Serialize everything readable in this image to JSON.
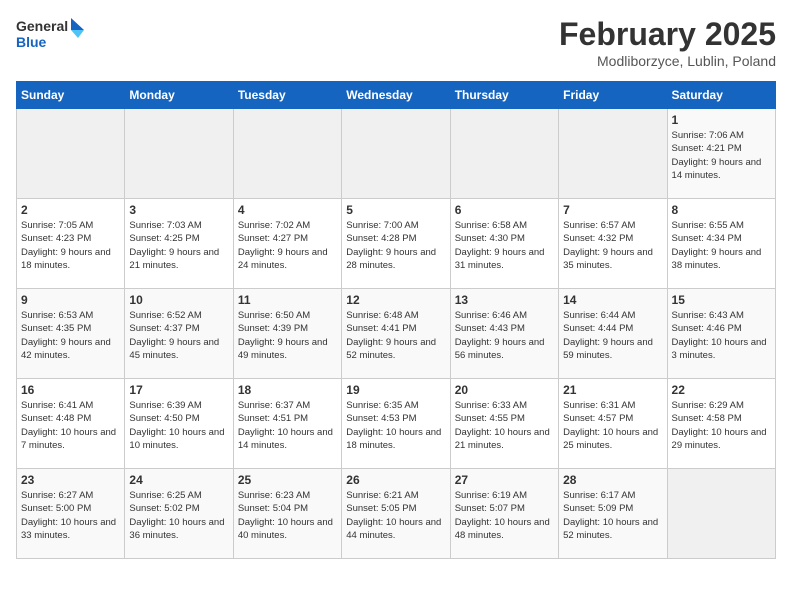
{
  "header": {
    "logo_general": "General",
    "logo_blue": "Blue",
    "title": "February 2025",
    "subtitle": "Modliborzyce, Lublin, Poland"
  },
  "days_of_week": [
    "Sunday",
    "Monday",
    "Tuesday",
    "Wednesday",
    "Thursday",
    "Friday",
    "Saturday"
  ],
  "weeks": [
    [
      {
        "day": "",
        "info": ""
      },
      {
        "day": "",
        "info": ""
      },
      {
        "day": "",
        "info": ""
      },
      {
        "day": "",
        "info": ""
      },
      {
        "day": "",
        "info": ""
      },
      {
        "day": "",
        "info": ""
      },
      {
        "day": "1",
        "info": "Sunrise: 7:06 AM\nSunset: 4:21 PM\nDaylight: 9 hours and 14 minutes."
      }
    ],
    [
      {
        "day": "2",
        "info": "Sunrise: 7:05 AM\nSunset: 4:23 PM\nDaylight: 9 hours and 18 minutes."
      },
      {
        "day": "3",
        "info": "Sunrise: 7:03 AM\nSunset: 4:25 PM\nDaylight: 9 hours and 21 minutes."
      },
      {
        "day": "4",
        "info": "Sunrise: 7:02 AM\nSunset: 4:27 PM\nDaylight: 9 hours and 24 minutes."
      },
      {
        "day": "5",
        "info": "Sunrise: 7:00 AM\nSunset: 4:28 PM\nDaylight: 9 hours and 28 minutes."
      },
      {
        "day": "6",
        "info": "Sunrise: 6:58 AM\nSunset: 4:30 PM\nDaylight: 9 hours and 31 minutes."
      },
      {
        "day": "7",
        "info": "Sunrise: 6:57 AM\nSunset: 4:32 PM\nDaylight: 9 hours and 35 minutes."
      },
      {
        "day": "8",
        "info": "Sunrise: 6:55 AM\nSunset: 4:34 PM\nDaylight: 9 hours and 38 minutes."
      }
    ],
    [
      {
        "day": "9",
        "info": "Sunrise: 6:53 AM\nSunset: 4:35 PM\nDaylight: 9 hours and 42 minutes."
      },
      {
        "day": "10",
        "info": "Sunrise: 6:52 AM\nSunset: 4:37 PM\nDaylight: 9 hours and 45 minutes."
      },
      {
        "day": "11",
        "info": "Sunrise: 6:50 AM\nSunset: 4:39 PM\nDaylight: 9 hours and 49 minutes."
      },
      {
        "day": "12",
        "info": "Sunrise: 6:48 AM\nSunset: 4:41 PM\nDaylight: 9 hours and 52 minutes."
      },
      {
        "day": "13",
        "info": "Sunrise: 6:46 AM\nSunset: 4:43 PM\nDaylight: 9 hours and 56 minutes."
      },
      {
        "day": "14",
        "info": "Sunrise: 6:44 AM\nSunset: 4:44 PM\nDaylight: 9 hours and 59 minutes."
      },
      {
        "day": "15",
        "info": "Sunrise: 6:43 AM\nSunset: 4:46 PM\nDaylight: 10 hours and 3 minutes."
      }
    ],
    [
      {
        "day": "16",
        "info": "Sunrise: 6:41 AM\nSunset: 4:48 PM\nDaylight: 10 hours and 7 minutes."
      },
      {
        "day": "17",
        "info": "Sunrise: 6:39 AM\nSunset: 4:50 PM\nDaylight: 10 hours and 10 minutes."
      },
      {
        "day": "18",
        "info": "Sunrise: 6:37 AM\nSunset: 4:51 PM\nDaylight: 10 hours and 14 minutes."
      },
      {
        "day": "19",
        "info": "Sunrise: 6:35 AM\nSunset: 4:53 PM\nDaylight: 10 hours and 18 minutes."
      },
      {
        "day": "20",
        "info": "Sunrise: 6:33 AM\nSunset: 4:55 PM\nDaylight: 10 hours and 21 minutes."
      },
      {
        "day": "21",
        "info": "Sunrise: 6:31 AM\nSunset: 4:57 PM\nDaylight: 10 hours and 25 minutes."
      },
      {
        "day": "22",
        "info": "Sunrise: 6:29 AM\nSunset: 4:58 PM\nDaylight: 10 hours and 29 minutes."
      }
    ],
    [
      {
        "day": "23",
        "info": "Sunrise: 6:27 AM\nSunset: 5:00 PM\nDaylight: 10 hours and 33 minutes."
      },
      {
        "day": "24",
        "info": "Sunrise: 6:25 AM\nSunset: 5:02 PM\nDaylight: 10 hours and 36 minutes."
      },
      {
        "day": "25",
        "info": "Sunrise: 6:23 AM\nSunset: 5:04 PM\nDaylight: 10 hours and 40 minutes."
      },
      {
        "day": "26",
        "info": "Sunrise: 6:21 AM\nSunset: 5:05 PM\nDaylight: 10 hours and 44 minutes."
      },
      {
        "day": "27",
        "info": "Sunrise: 6:19 AM\nSunset: 5:07 PM\nDaylight: 10 hours and 48 minutes."
      },
      {
        "day": "28",
        "info": "Sunrise: 6:17 AM\nSunset: 5:09 PM\nDaylight: 10 hours and 52 minutes."
      },
      {
        "day": "",
        "info": ""
      }
    ]
  ]
}
